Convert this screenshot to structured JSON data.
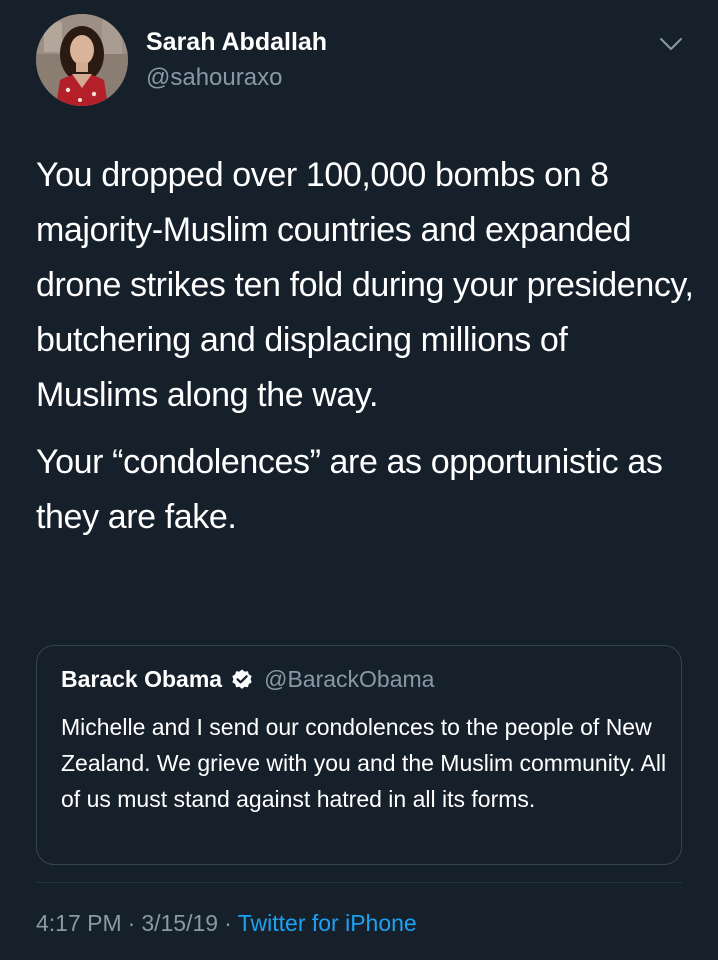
{
  "author": {
    "name": "Sarah Abdallah",
    "handle": "@sahouraxo"
  },
  "tweet": {
    "paragraphs": [
      "You dropped over 100,000 bombs on 8 majority-Muslim countries and expanded drone strikes ten fold during your presidency, butchering and displacing millions of Muslims along the way.",
      "Your “condolences” are as opportunistic as they are fake."
    ]
  },
  "quoted_tweet": {
    "name": "Barack Obama",
    "handle": "@BarackObama",
    "verified": true,
    "text": "Michelle and I send our condolences to the people of New Zealand. We grieve with you and the Muslim community. All of us must stand against hatred in all its forms."
  },
  "meta": {
    "time": "4:17 PM",
    "date": "3/15/19",
    "separator": "·",
    "source": "Twitter for iPhone"
  },
  "icons": {
    "menu": "chevron-down-icon",
    "verified": "verified-badge-icon"
  },
  "colors": {
    "background": "#15202b",
    "text": "#ffffff",
    "secondary_text": "#8899a6",
    "link": "#1da1f2",
    "border": "#38444d"
  }
}
